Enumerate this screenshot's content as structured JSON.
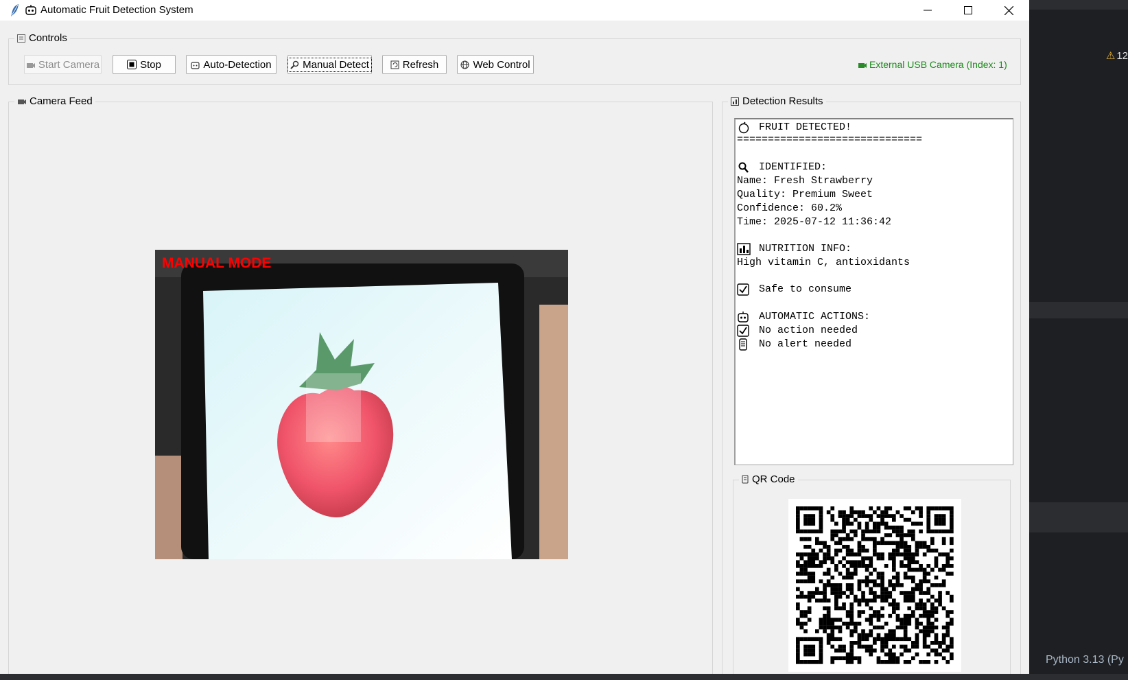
{
  "window": {
    "title": "Automatic Fruit Detection System"
  },
  "controls": {
    "group_label": "Controls",
    "buttons": {
      "start": "Start Camera",
      "stop": "Stop",
      "auto": "Auto-Detection",
      "manual": "Manual Detect",
      "refresh": "Refresh",
      "web": "Web Control"
    },
    "camera_status": "External USB Camera (Index: 1)",
    "status_color": "#1a8a1a"
  },
  "camera_feed": {
    "group_label": "Camera Feed",
    "overlay_text": "MANUAL MODE",
    "overlay_color": "#ff0000"
  },
  "results": {
    "group_label": "Detection Results",
    "header": "FRUIT DETECTED!",
    "separator": "==============================",
    "identified_heading": "IDENTIFIED:",
    "name_line": "Name: Fresh Strawberry",
    "quality_line": "Quality: Premium Sweet",
    "confidence_line": "Confidence: 60.2%",
    "time_line": "Time: 2025-07-12 11:36:42",
    "nutrition_heading": "NUTRITION INFO:",
    "nutrition_text": "High vitamin C, antioxidants",
    "safety_text": "Safe to consume",
    "actions_heading": "AUTOMATIC ACTIONS:",
    "action_1": "No action needed",
    "action_2": "No alert needed"
  },
  "qr": {
    "group_label": "QR Code"
  },
  "background_ide": {
    "warning_count": "12",
    "status_text": "Python 3.13 (Py"
  }
}
